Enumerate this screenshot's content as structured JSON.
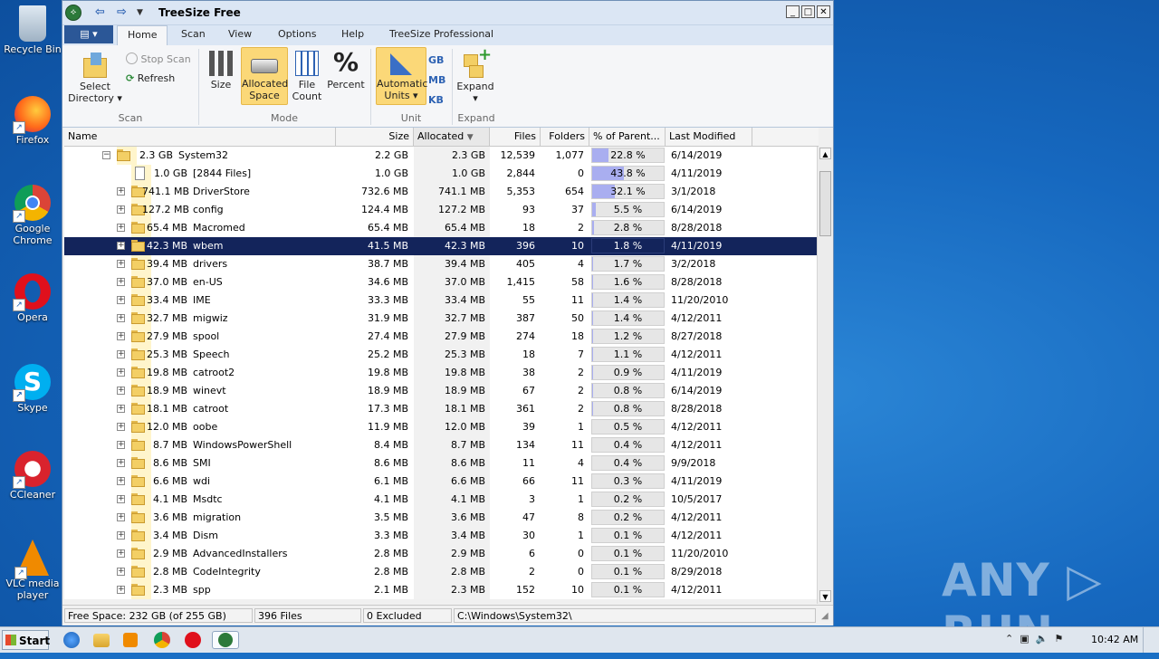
{
  "desktop": {
    "icons": [
      {
        "label": "Recycle Bin",
        "icon": "recycle-bin-icon"
      },
      {
        "label": "Firefox",
        "icon": "firefox-icon"
      },
      {
        "label": "Google Chrome",
        "icon": "chrome-icon"
      },
      {
        "label": "Opera",
        "icon": "opera-icon"
      },
      {
        "label": "Skype",
        "icon": "skype-icon"
      },
      {
        "label": "CCleaner",
        "icon": "ccleaner-icon"
      },
      {
        "label": "VLC media player",
        "icon": "vlc-icon"
      }
    ],
    "watermark": "ANY ▷ RUN"
  },
  "window": {
    "title": "TreeSize Free",
    "file_menu_icon": "menu-icon",
    "tabs": [
      "Home",
      "Scan",
      "View",
      "Options",
      "Help",
      "TreeSize Professional"
    ],
    "active_tab": "Home"
  },
  "ribbon": {
    "scan_group": {
      "label": "Scan",
      "select_directory": "Select Directory",
      "stop_scan": "Stop Scan",
      "refresh": "Refresh"
    },
    "mode_group": {
      "label": "Mode",
      "size": "Size",
      "allocated_space": "Allocated Space",
      "file_count": "File Count",
      "percent": "Percent"
    },
    "unit_group": {
      "label": "Unit",
      "automatic_units": "Automatic Units",
      "gb": "GB",
      "mb": "MB",
      "kb": "KB"
    },
    "expand_group": {
      "label": "Expand",
      "expand": "Expand"
    }
  },
  "columns": [
    "Name",
    "Size",
    "Allocated",
    "Files",
    "Folders",
    "% of Parent...",
    "Last Modified"
  ],
  "rows": [
    {
      "level": 0,
      "expand": "−",
      "icon": "folder",
      "size_label": "2.3 GB",
      "name": "System32",
      "size": "2.2 GB",
      "allocated": "2.3 GB",
      "files": "12,539",
      "folders": "1,077",
      "pct": "22.8 %",
      "pct_value": 22.8,
      "modified": "6/14/2019"
    },
    {
      "level": 1,
      "expand": "",
      "icon": "file",
      "size_label": "1.0 GB",
      "name": "[2844 Files]",
      "size": "1.0 GB",
      "allocated": "1.0 GB",
      "files": "2,844",
      "folders": "0",
      "pct": "43.8 %",
      "pct_value": 43.8,
      "modified": "4/11/2019"
    },
    {
      "level": 1,
      "expand": "+",
      "icon": "folder",
      "size_label": "741.1 MB",
      "name": "DriverStore",
      "size": "732.6 MB",
      "allocated": "741.1 MB",
      "files": "5,353",
      "folders": "654",
      "pct": "32.1 %",
      "pct_value": 32.1,
      "modified": "3/1/2018"
    },
    {
      "level": 1,
      "expand": "+",
      "icon": "folder",
      "size_label": "127.2 MB",
      "name": "config",
      "size": "124.4 MB",
      "allocated": "127.2 MB",
      "files": "93",
      "folders": "37",
      "pct": "5.5 %",
      "pct_value": 5.5,
      "modified": "6/14/2019"
    },
    {
      "level": 1,
      "expand": "+",
      "icon": "folder",
      "size_label": "65.4 MB",
      "name": "Macromed",
      "size": "65.4 MB",
      "allocated": "65.4 MB",
      "files": "18",
      "folders": "2",
      "pct": "2.8 %",
      "pct_value": 2.8,
      "modified": "8/28/2018"
    },
    {
      "level": 1,
      "expand": "+",
      "icon": "folder",
      "size_label": "42.3 MB",
      "name": "wbem",
      "size": "41.5 MB",
      "allocated": "42.3 MB",
      "files": "396",
      "folders": "10",
      "pct": "1.8 %",
      "pct_value": 1.8,
      "modified": "4/11/2019",
      "selected": true
    },
    {
      "level": 1,
      "expand": "+",
      "icon": "folder",
      "size_label": "39.4 MB",
      "name": "drivers",
      "size": "38.7 MB",
      "allocated": "39.4 MB",
      "files": "405",
      "folders": "4",
      "pct": "1.7 %",
      "pct_value": 1.7,
      "modified": "3/2/2018"
    },
    {
      "level": 1,
      "expand": "+",
      "icon": "folder",
      "size_label": "37.0 MB",
      "name": "en-US",
      "size": "34.6 MB",
      "allocated": "37.0 MB",
      "files": "1,415",
      "folders": "58",
      "pct": "1.6 %",
      "pct_value": 1.6,
      "modified": "8/28/2018"
    },
    {
      "level": 1,
      "expand": "+",
      "icon": "folder",
      "size_label": "33.4 MB",
      "name": "IME",
      "size": "33.3 MB",
      "allocated": "33.4 MB",
      "files": "55",
      "folders": "11",
      "pct": "1.4 %",
      "pct_value": 1.4,
      "modified": "11/20/2010"
    },
    {
      "level": 1,
      "expand": "+",
      "icon": "folder",
      "size_label": "32.7 MB",
      "name": "migwiz",
      "size": "31.9 MB",
      "allocated": "32.7 MB",
      "files": "387",
      "folders": "50",
      "pct": "1.4 %",
      "pct_value": 1.4,
      "modified": "4/12/2011"
    },
    {
      "level": 1,
      "expand": "+",
      "icon": "folder",
      "size_label": "27.9 MB",
      "name": "spool",
      "size": "27.4 MB",
      "allocated": "27.9 MB",
      "files": "274",
      "folders": "18",
      "pct": "1.2 %",
      "pct_value": 1.2,
      "modified": "8/27/2018"
    },
    {
      "level": 1,
      "expand": "+",
      "icon": "folder",
      "size_label": "25.3 MB",
      "name": "Speech",
      "size": "25.2 MB",
      "allocated": "25.3 MB",
      "files": "18",
      "folders": "7",
      "pct": "1.1 %",
      "pct_value": 1.1,
      "modified": "4/12/2011"
    },
    {
      "level": 1,
      "expand": "+",
      "icon": "folder",
      "size_label": "19.8 MB",
      "name": "catroot2",
      "size": "19.8 MB",
      "allocated": "19.8 MB",
      "files": "38",
      "folders": "2",
      "pct": "0.9 %",
      "pct_value": 0.9,
      "modified": "4/11/2019"
    },
    {
      "level": 1,
      "expand": "+",
      "icon": "folder",
      "size_label": "18.9 MB",
      "name": "winevt",
      "size": "18.9 MB",
      "allocated": "18.9 MB",
      "files": "67",
      "folders": "2",
      "pct": "0.8 %",
      "pct_value": 0.8,
      "modified": "6/14/2019"
    },
    {
      "level": 1,
      "expand": "+",
      "icon": "folder",
      "size_label": "18.1 MB",
      "name": "catroot",
      "size": "17.3 MB",
      "allocated": "18.1 MB",
      "files": "361",
      "folders": "2",
      "pct": "0.8 %",
      "pct_value": 0.8,
      "modified": "8/28/2018"
    },
    {
      "level": 1,
      "expand": "+",
      "icon": "folder",
      "size_label": "12.0 MB",
      "name": "oobe",
      "size": "11.9 MB",
      "allocated": "12.0 MB",
      "files": "39",
      "folders": "1",
      "pct": "0.5 %",
      "pct_value": 0.5,
      "modified": "4/12/2011"
    },
    {
      "level": 1,
      "expand": "+",
      "icon": "folder",
      "size_label": "8.7 MB",
      "name": "WindowsPowerShell",
      "size": "8.4 MB",
      "allocated": "8.7 MB",
      "files": "134",
      "folders": "11",
      "pct": "0.4 %",
      "pct_value": 0.4,
      "modified": "4/12/2011"
    },
    {
      "level": 1,
      "expand": "+",
      "icon": "folder",
      "size_label": "8.6 MB",
      "name": "SMI",
      "size": "8.6 MB",
      "allocated": "8.6 MB",
      "files": "11",
      "folders": "4",
      "pct": "0.4 %",
      "pct_value": 0.4,
      "modified": "9/9/2018"
    },
    {
      "level": 1,
      "expand": "+",
      "icon": "folder",
      "size_label": "6.6 MB",
      "name": "wdi",
      "size": "6.1 MB",
      "allocated": "6.6 MB",
      "files": "66",
      "folders": "11",
      "pct": "0.3 %",
      "pct_value": 0.3,
      "modified": "4/11/2019"
    },
    {
      "level": 1,
      "expand": "+",
      "icon": "folder",
      "size_label": "4.1 MB",
      "name": "Msdtc",
      "size": "4.1 MB",
      "allocated": "4.1 MB",
      "files": "3",
      "folders": "1",
      "pct": "0.2 %",
      "pct_value": 0.2,
      "modified": "10/5/2017"
    },
    {
      "level": 1,
      "expand": "+",
      "icon": "folder",
      "size_label": "3.6 MB",
      "name": "migration",
      "size": "3.5 MB",
      "allocated": "3.6 MB",
      "files": "47",
      "folders": "8",
      "pct": "0.2 %",
      "pct_value": 0.2,
      "modified": "4/12/2011"
    },
    {
      "level": 1,
      "expand": "+",
      "icon": "folder",
      "size_label": "3.4 MB",
      "name": "Dism",
      "size": "3.3 MB",
      "allocated": "3.4 MB",
      "files": "30",
      "folders": "1",
      "pct": "0.1 %",
      "pct_value": 0.1,
      "modified": "4/12/2011"
    },
    {
      "level": 1,
      "expand": "+",
      "icon": "folder",
      "size_label": "2.9 MB",
      "name": "AdvancedInstallers",
      "size": "2.8 MB",
      "allocated": "2.9 MB",
      "files": "6",
      "folders": "0",
      "pct": "0.1 %",
      "pct_value": 0.1,
      "modified": "11/20/2010"
    },
    {
      "level": 1,
      "expand": "+",
      "icon": "folder",
      "size_label": "2.8 MB",
      "name": "CodeIntegrity",
      "size": "2.8 MB",
      "allocated": "2.8 MB",
      "files": "2",
      "folders": "0",
      "pct": "0.1 %",
      "pct_value": 0.1,
      "modified": "8/29/2018"
    },
    {
      "level": 1,
      "expand": "+",
      "icon": "folder",
      "size_label": "2.3 MB",
      "name": "spp",
      "size": "2.1 MB",
      "allocated": "2.3 MB",
      "files": "152",
      "folders": "10",
      "pct": "0.1 %",
      "pct_value": 0.1,
      "modified": "4/12/2011"
    }
  ],
  "statusbar": {
    "free_space": "Free Space: 232 GB  (of 255 GB)",
    "files": "396  Files",
    "excluded": "0 Excluded",
    "path": "C:\\Windows\\System32\\"
  },
  "taskbar": {
    "start": "Start",
    "apps": [
      "ie-icon",
      "explorer-icon",
      "media-player-icon",
      "chrome-icon",
      "opera-icon",
      "treesize-icon"
    ],
    "clock": "10:42 AM"
  },
  "colors": {
    "selection": "#13245b",
    "percent_bar": "#a9aef0",
    "ribbon_active": "#fbd878",
    "desktop": "#1668bf"
  }
}
